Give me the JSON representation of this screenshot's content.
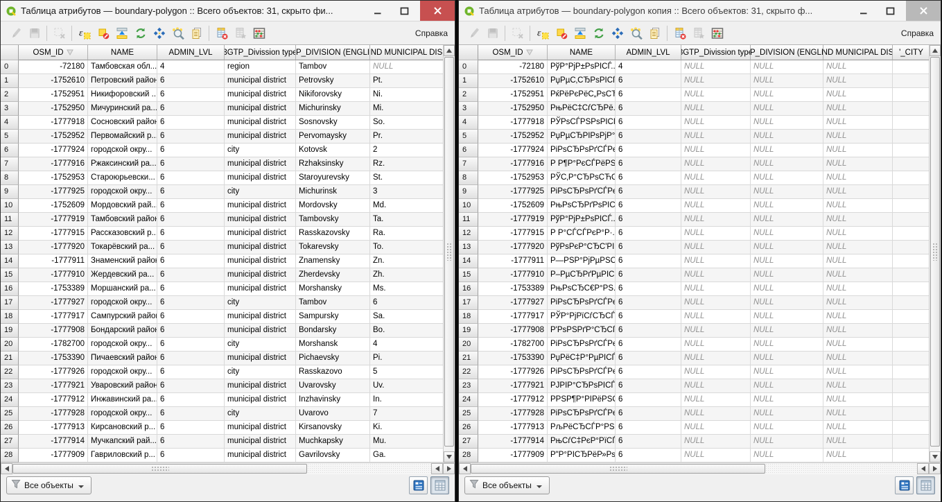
{
  "labels": {
    "help": "Справка",
    "all_features": "Все объекты"
  },
  "icons": {
    "window_logo": "qgis-logo-icon",
    "window_buttons": [
      "minimize-icon",
      "maximize-icon",
      "close-icon"
    ],
    "sort_indicator": "sort-down-icon",
    "filter": "filter-funnel-icon",
    "dropdown": "caret-down-icon",
    "view_buttons": [
      "form-view-icon",
      "table-view-icon"
    ]
  },
  "toolbar": {
    "icons": [
      {
        "name": "toggle-editing-icon",
        "disabled": true
      },
      {
        "name": "save-edits-icon",
        "disabled": true
      },
      {
        "name": "deselect-all-icon",
        "disabled": true,
        "sep_before": true
      },
      {
        "name": "select-by-expression-icon",
        "disabled": false,
        "sep_before": true
      },
      {
        "name": "unselect-all-icon",
        "disabled": false
      },
      {
        "name": "move-selection-to-top-icon",
        "disabled": false
      },
      {
        "name": "invert-selection-icon",
        "disabled": false
      },
      {
        "name": "pan-to-selected-icon",
        "disabled": false
      },
      {
        "name": "zoom-to-selected-icon",
        "disabled": false
      },
      {
        "name": "copy-rows-icon",
        "disabled": false
      },
      {
        "name": "delete-column-icon",
        "disabled": false,
        "sep_before": true
      },
      {
        "name": "new-column-icon",
        "disabled": true
      },
      {
        "name": "field-calculator-icon",
        "disabled": false
      }
    ]
  },
  "left_window": {
    "title": "Таблица атрибутов — boundary-polygon :: Всего объектов: 31, скрыто фи...",
    "columns": [
      "OSM_ID",
      "NAME",
      "ADMIN_LVL",
      "3GTP_Divission type",
      "P_DIVISION (ENGLI",
      "ND MUNICIPAL DIS"
    ],
    "rows": [
      [
        "-72180",
        "Тамбовская обл...",
        "4",
        "region",
        "Tambov",
        "NULL"
      ],
      [
        "-1752610",
        "Петровский район",
        "6",
        "municipal district",
        "Petrovsky",
        "Pt."
      ],
      [
        "-1752951",
        "Никифоровский ...",
        "6",
        "municipal district",
        "Nikiforovsky",
        "Ni."
      ],
      [
        "-1752950",
        "Мичуринский ра...",
        "6",
        "municipal district",
        "Michurinsky",
        "Mi."
      ],
      [
        "-1777918",
        "Сосновский район",
        "6",
        "municipal district",
        "Sosnovsky",
        "So."
      ],
      [
        "-1752952",
        "Первомайский р...",
        "6",
        "municipal district",
        "Pervomaysky",
        "Pr."
      ],
      [
        "-1777924",
        "городской окру...",
        "6",
        "city",
        "Kotovsk",
        "2"
      ],
      [
        "-1777916",
        "Ржаксинский ра...",
        "6",
        "municipal district",
        "Rzhaksinsky",
        "Rz."
      ],
      [
        "-1752953",
        "Староюрьевски...",
        "6",
        "municipal district",
        "Staroyurevsky",
        "St."
      ],
      [
        "-1777925",
        "городской окру...",
        "6",
        "city",
        "Michurinsk",
        "3"
      ],
      [
        "-1752609",
        "Мордовский рай...",
        "6",
        "municipal district",
        "Mordovsky",
        "Md."
      ],
      [
        "-1777919",
        "Тамбовский район",
        "6",
        "municipal district",
        "Tambovsky",
        "Ta."
      ],
      [
        "-1777915",
        "Рассказовский р...",
        "6",
        "municipal district",
        "Rasskazovsky",
        "Ra."
      ],
      [
        "-1777920",
        "Токарёвский ра...",
        "6",
        "municipal district",
        "Tokarevsky",
        "To."
      ],
      [
        "-1777911",
        "Знаменский район",
        "6",
        "municipal district",
        "Znamensky",
        "Zn."
      ],
      [
        "-1777910",
        "Жердевский ра...",
        "6",
        "municipal district",
        "Zherdevsky",
        "Zh."
      ],
      [
        "-1753389",
        "Моршанский ра...",
        "6",
        "municipal district",
        "Morshansky",
        "Ms."
      ],
      [
        "-1777927",
        "городской окру...",
        "6",
        "city",
        "Tambov",
        "6"
      ],
      [
        "-1777917",
        "Сампурский район",
        "6",
        "municipal district",
        "Sampursky",
        "Sa."
      ],
      [
        "-1777908",
        "Бондарский район",
        "6",
        "municipal district",
        "Bondarsky",
        "Bo."
      ],
      [
        "-1782700",
        "городской окру...",
        "6",
        "city",
        "Morshansk",
        "4"
      ],
      [
        "-1753390",
        "Пичаевский район",
        "6",
        "municipal district",
        "Pichaevsky",
        "Pi."
      ],
      [
        "-1777926",
        "городской окру...",
        "6",
        "city",
        "Rasskazovo",
        "5"
      ],
      [
        "-1777921",
        "Уваровский район",
        "6",
        "municipal district",
        "Uvarovsky",
        "Uv."
      ],
      [
        "-1777912",
        "Инжавинский ра...",
        "6",
        "municipal district",
        "Inzhavinsky",
        "In."
      ],
      [
        "-1777928",
        "городской окру...",
        "6",
        "city",
        "Uvarovo",
        "7"
      ],
      [
        "-1777913",
        "Кирсановский р...",
        "6",
        "municipal district",
        "Kirsanovsky",
        "Ki."
      ],
      [
        "-1777914",
        "Мучкапский рай...",
        "6",
        "municipal district",
        "Muchkapsky",
        "Mu."
      ],
      [
        "-1777909",
        "Гавриловский р...",
        "6",
        "municipal district",
        "Gavrilovsky",
        "Ga."
      ]
    ]
  },
  "right_window": {
    "title": "Таблица атрибутов — boundary-polygon копия :: Всего объектов: 31, скрыто ф...",
    "columns": [
      "OSM_ID",
      "NAME",
      "ADMIN_LVL",
      "3GTP_Divission type",
      "P_DIVISION (ENGLI",
      "ND MUNICIPAL DIS",
      "'_CITY"
    ],
    "rows": [
      [
        "-72180",
        "РўР°РјР±РѕРІСЃ...",
        "4",
        "NULL",
        "NULL",
        "NULL",
        ""
      ],
      [
        "-1752610",
        "РџРµС‚СЂРѕРІСЃ...",
        "6",
        "NULL",
        "NULL",
        "NULL",
        ""
      ],
      [
        "-1752951",
        "РќРёРєРёС„РѕСЂ...",
        "6",
        "NULL",
        "NULL",
        "NULL",
        ""
      ],
      [
        "-1752950",
        "РњРёС‡СѓСЂРё...",
        "6",
        "NULL",
        "NULL",
        "NULL",
        ""
      ],
      [
        "-1777918",
        "РЎРѕСЃРЅРѕРІСЃ...",
        "6",
        "NULL",
        "NULL",
        "NULL",
        ""
      ],
      [
        "-1752952",
        "РџРµСЂРІРѕРјР°...",
        "6",
        "NULL",
        "NULL",
        "NULL",
        ""
      ],
      [
        "-1777924",
        "РіРѕСЂРѕРґСЃРє...",
        "6",
        "NULL",
        "NULL",
        "NULL",
        ""
      ],
      [
        "-1777916",
        "Р Р¶Р°РєСЃРёРЅ...",
        "6",
        "NULL",
        "NULL",
        "NULL",
        ""
      ],
      [
        "-1752953",
        "РЎС‚Р°СЂРѕСЋСЂ...",
        "6",
        "NULL",
        "NULL",
        "NULL",
        ""
      ],
      [
        "-1777925",
        "РіРѕСЂРѕРґСЃРє...",
        "6",
        "NULL",
        "NULL",
        "NULL",
        ""
      ],
      [
        "-1752609",
        "РњРѕСЂРґРѕРІС...",
        "6",
        "NULL",
        "NULL",
        "NULL",
        ""
      ],
      [
        "-1777919",
        "РўР°РјР±РѕРІСЃ...",
        "6",
        "NULL",
        "NULL",
        "NULL",
        ""
      ],
      [
        "-1777915",
        "Р Р°СЃСЃРєР°Р·...",
        "6",
        "NULL",
        "NULL",
        "NULL",
        ""
      ],
      [
        "-1777920",
        "РўРѕРєР°СЂС'РІ...",
        "6",
        "NULL",
        "NULL",
        "NULL",
        ""
      ],
      [
        "-1777911",
        "Р—РЅР°РјРµРЅС...",
        "6",
        "NULL",
        "NULL",
        "NULL",
        ""
      ],
      [
        "-1777910",
        "Р–РµСЂРґРµРІС...",
        "6",
        "NULL",
        "NULL",
        "NULL",
        ""
      ],
      [
        "-1753389",
        "РњРѕСЂС€Р°РЅ...",
        "6",
        "NULL",
        "NULL",
        "NULL",
        ""
      ],
      [
        "-1777927",
        "РіРѕСЂРѕРґСЃРє...",
        "6",
        "NULL",
        "NULL",
        "NULL",
        ""
      ],
      [
        "-1777917",
        "РЎР°РјРїСѓСЂСЃ...",
        "6",
        "NULL",
        "NULL",
        "NULL",
        ""
      ],
      [
        "-1777908",
        "Р'РѕРЅРґР°СЂСЃ...",
        "6",
        "NULL",
        "NULL",
        "NULL",
        ""
      ],
      [
        "-1782700",
        "РіРѕСЂРѕРґСЃРє...",
        "6",
        "NULL",
        "NULL",
        "NULL",
        ""
      ],
      [
        "-1753390",
        "РџРёС‡Р°РµРІСЃ...",
        "6",
        "NULL",
        "NULL",
        "NULL",
        ""
      ],
      [
        "-1777926",
        "РіРѕСЂРѕРґСЃРє...",
        "6",
        "NULL",
        "NULL",
        "NULL",
        ""
      ],
      [
        "-1777921",
        "РЈРІР°СЂРѕРІСЃ...",
        "6",
        "NULL",
        "NULL",
        "NULL",
        ""
      ],
      [
        "-1777912",
        "РРЅР¶Р°РІРёРЅС...",
        "6",
        "NULL",
        "NULL",
        "NULL",
        ""
      ],
      [
        "-1777928",
        "РіРѕСЂРѕРґСЃРє...",
        "6",
        "NULL",
        "NULL",
        "NULL",
        ""
      ],
      [
        "-1777913",
        "РљРёСЂСЃР°РЅ...",
        "6",
        "NULL",
        "NULL",
        "NULL",
        ""
      ],
      [
        "-1777914",
        "РњСѓС‡РєР°РїСЃ...",
        "6",
        "NULL",
        "NULL",
        "NULL",
        ""
      ],
      [
        "-1777909",
        "Р\"Р°РІСЂРёР»Рѕ...",
        "6",
        "NULL",
        "NULL",
        "NULL",
        ""
      ]
    ]
  }
}
